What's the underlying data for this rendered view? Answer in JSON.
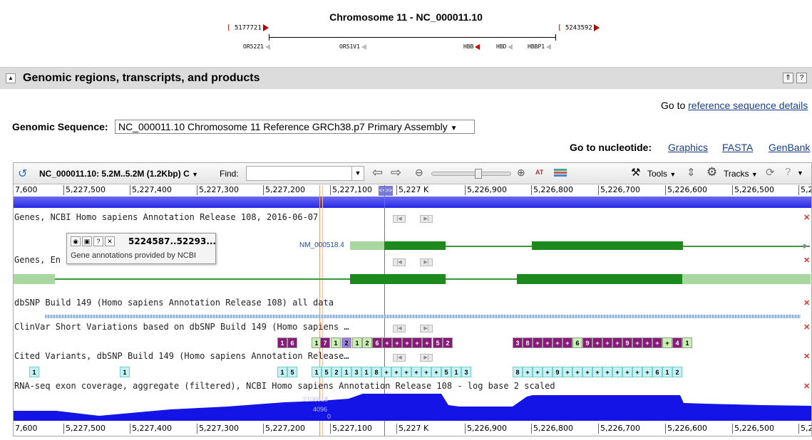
{
  "ideogram": {
    "title": "Chromosome 11 - NC_000011.10",
    "left_coord": "5177721",
    "right_coord": "5243592",
    "genes": [
      {
        "label": "OR52Z1",
        "color": "#bbbbbb"
      },
      {
        "label": "OR51V1",
        "color": "#bbbbbb"
      },
      {
        "label": "HBB",
        "color": "#cc0000"
      },
      {
        "label": "HBD",
        "color": "#bbbbbb"
      },
      {
        "label": "HBBP1",
        "color": "#bbbbbb"
      }
    ]
  },
  "section": {
    "title": "Genomic regions, transcripts, and products",
    "toggle_icon": "collapse-icon",
    "go_to_prefix": "Go to",
    "go_to_link": "reference sequence details"
  },
  "genomic_sequence": {
    "label": "Genomic Sequence:",
    "selected": "NC_000011.10 Chromosome 11 Reference GRCh38.p7 Primary Assembly"
  },
  "nucleotide_links": {
    "label": "Go to nucleotide:",
    "links": [
      "Graphics",
      "FASTA",
      "GenBank"
    ]
  },
  "toolbar": {
    "location": "NC_000011.10: 5.2M..5.2M (1.2Kbp) C",
    "find_label": "Find:",
    "find_value": "",
    "tools_label": "Tools",
    "tracks_label": "Tracks",
    "zoom_level": 0.6
  },
  "ruler": {
    "ticks": [
      "7,600",
      "5,227,500",
      "5,227,400",
      "5,227,300",
      "5,227,200",
      "5,227,100",
      "5,227 K",
      "5,226,900",
      "5,226,800",
      "5,226,700",
      "5,226,600",
      "5,226,500",
      "5,2"
    ],
    "marker": "<<>>"
  },
  "tracks": {
    "genes_ncbi": "Genes, NCBI Homo sapiens Annotation Release 108, 2016-06-07",
    "genes_ensembl": "Genes, En",
    "dbsnp": "dbSNP Build 149 (Homo sapiens Annotation Release 108) all data",
    "clinvar": "ClinVar Short Variations based on dbSNP Build 149 (Homo sapiens …",
    "cited": "Cited Variants, dbSNP Build 149 (Homo sapiens Annotation Release…",
    "rnaseq": "RNA-seq exon coverage, aggregate (filtered), NCBI Homo sapiens Annotation Release 108 - log base 2 scaled",
    "rnaseq_max": "2106818",
    "rnaseq_mid": "4096",
    "rnaseq_min": "0"
  },
  "transcript": {
    "name": "NM_000518.4"
  },
  "tooltip": {
    "range": "5224587..52293...",
    "text": "Gene annotations provided by NCBI"
  },
  "clinvar_variants": [
    {
      "t": "1",
      "k": "p"
    },
    {
      "t": "6",
      "k": "p"
    },
    {
      "t": "1",
      "k": "g"
    },
    {
      "t": "7",
      "k": "p"
    },
    {
      "t": "1",
      "k": "g"
    },
    {
      "t": "2",
      "k": "b"
    },
    {
      "t": "1",
      "k": "g"
    },
    {
      "t": "2",
      "k": "g"
    },
    {
      "t": "6",
      "k": "p"
    },
    {
      "t": "+",
      "k": "p"
    },
    {
      "t": "+",
      "k": "p"
    },
    {
      "t": "+",
      "k": "p"
    },
    {
      "t": "+",
      "k": "p"
    },
    {
      "t": "+",
      "k": "p"
    },
    {
      "t": "5",
      "k": "p"
    },
    {
      "t": "2",
      "k": "p"
    },
    {
      "t": "3",
      "k": "p"
    },
    {
      "t": "8",
      "k": "p"
    },
    {
      "t": "+",
      "k": "p"
    },
    {
      "t": "+",
      "k": "p"
    },
    {
      "t": "+",
      "k": "p"
    },
    {
      "t": "+",
      "k": "p"
    },
    {
      "t": "6",
      "k": "g"
    },
    {
      "t": "9",
      "k": "p"
    },
    {
      "t": "+",
      "k": "p"
    },
    {
      "t": "+",
      "k": "p"
    },
    {
      "t": "+",
      "k": "p"
    },
    {
      "t": "9",
      "k": "p"
    },
    {
      "t": "+",
      "k": "p"
    },
    {
      "t": "+",
      "k": "p"
    },
    {
      "t": "+",
      "k": "p"
    },
    {
      "t": "+",
      "k": "g"
    },
    {
      "t": "4",
      "k": "p"
    },
    {
      "t": "1",
      "k": "g"
    }
  ],
  "cited_variants": [
    "1",
    "1",
    "1",
    "5",
    "1",
    "5",
    "2",
    "1",
    "3",
    "1",
    "8",
    "+",
    "+",
    "+",
    "+",
    "+",
    "+",
    "5",
    "1",
    "3",
    "8",
    "+",
    "+",
    "+",
    "9",
    "+",
    "+",
    "+",
    "+",
    "+",
    "+",
    "+",
    "+",
    "+",
    "6",
    "1",
    "2"
  ]
}
